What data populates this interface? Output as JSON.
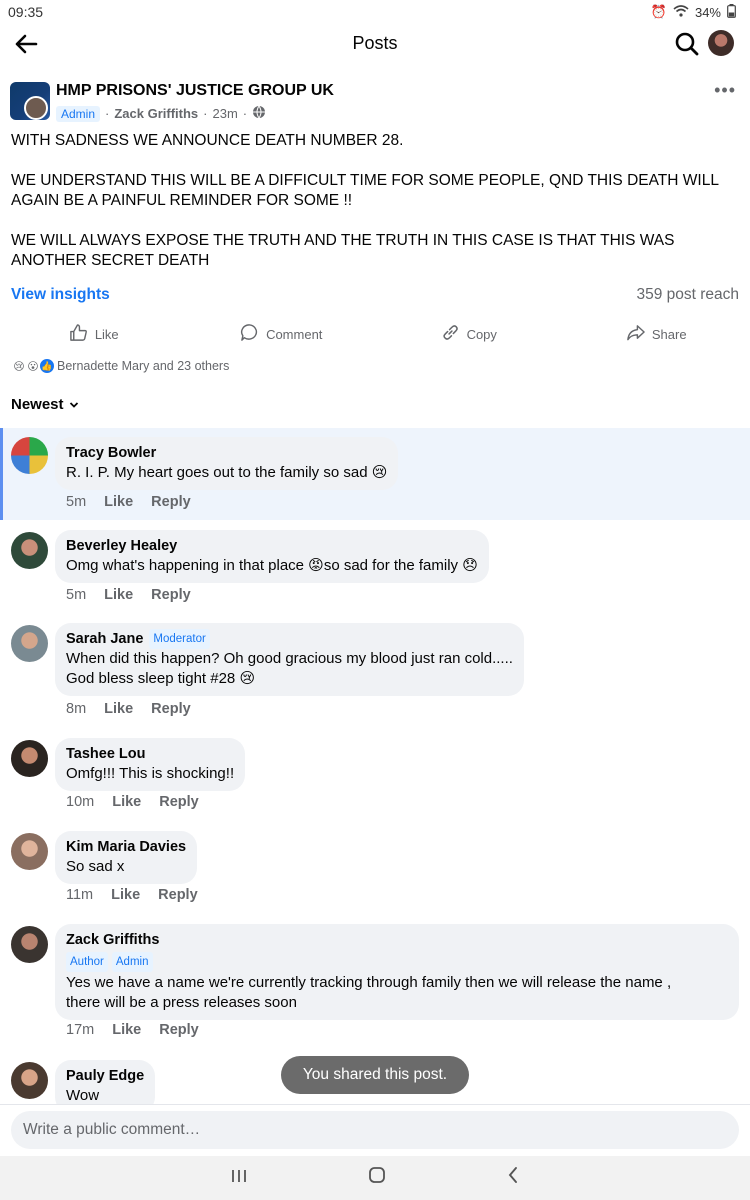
{
  "status": {
    "time": "09:35",
    "battery": "34%"
  },
  "header": {
    "title": "Posts"
  },
  "post": {
    "group_name": "HMP PRISONS' JUSTICE GROUP UK",
    "admin_tag": "Admin",
    "author": "Zack Griffiths",
    "time": "23m",
    "paragraphs": [
      "WITH SADNESS WE ANNOUNCE DEATH NUMBER 28.",
      "WE UNDERSTAND THIS WILL BE A DIFFICULT TIME FOR SOME PEOPLE, QND THIS DEATH WILL AGAIN BE A PAINFUL REMINDER FOR SOME !!",
      "WE WILL ALWAYS EXPOSE THE TRUTH AND THE TRUTH IN THIS CASE IS THAT THIS WAS ANOTHER SECRET DEATH"
    ],
    "view_insights": "View insights",
    "reach": "359 post reach",
    "actions": {
      "like": "Like",
      "comment": "Comment",
      "copy": "Copy",
      "share": "Share"
    },
    "reactions_text": "Bernadette Mary and 23 others"
  },
  "sort_label": "Newest",
  "comments": [
    {
      "name": "Tracy Bowler",
      "text": "R. I. P.  My heart goes out to the family so sad 😢",
      "time": "5m",
      "like": "Like",
      "reply": "Reply"
    },
    {
      "name": "Beverley Healey",
      "text": "Omg what's happening in that place 😡so sad for the family 😞",
      "time": "5m",
      "like": "Like",
      "reply": "Reply"
    },
    {
      "name": "Sarah Jane",
      "tag": "Moderator",
      "text_lines": [
        "When did this happen? Oh good gracious my blood just ran cold.....",
        "God bless sleep tight  #28 😢"
      ],
      "time": "8m",
      "like": "Like",
      "reply": "Reply"
    },
    {
      "name": "Tashee Lou",
      "text": "Omfg!!! This is shocking!!",
      "time": "10m",
      "like": "Like",
      "reply": "Reply"
    },
    {
      "name": "Kim Maria Davies",
      "text": "So sad x",
      "time": "11m",
      "like": "Like",
      "reply": "Reply"
    },
    {
      "name": "Zack Griffiths",
      "tags": [
        "Author",
        "Admin"
      ],
      "text_lines": [
        "Yes we have a name we're currently tracking through family then we will release the name ,",
        "there will be a press releases soon"
      ],
      "time": "17m",
      "like": "Like",
      "reply": "Reply"
    },
    {
      "name": "Pauly Edge",
      "text": "Wow"
    }
  ],
  "toast": "You shared this post.",
  "composer_placeholder": "Write a public comment…"
}
